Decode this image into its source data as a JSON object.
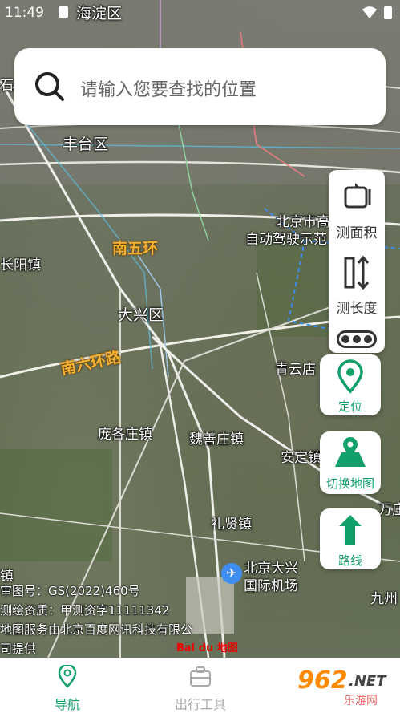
{
  "status_bar": {
    "time": "11:49",
    "district": "海淀区"
  },
  "search": {
    "placeholder": "请输入您要查找的位置"
  },
  "map_labels": {
    "fengtai": "丰台区",
    "south_5th_ring": "南五环",
    "changyang": "长阳镇",
    "daxing": "大兴区",
    "south_6th_ring": "南六环路",
    "qingyundian": "青云店",
    "panggezhuang": "庞各庄镇",
    "weishanzhuang": "魏善庄镇",
    "anding": "安定镇",
    "lixian": "礼贤镇",
    "airport_line1": "北京大兴",
    "airport_line2": "国际机场",
    "wanzhuang": "万庄",
    "jiuzhou": "九州",
    "beijing_city_line1": "北京市高",
    "beijing_city_line2": "自动驾驶示范",
    "town_left": "镇",
    "top_left": "石景"
  },
  "tools": {
    "area_label": "测面积",
    "length_label": "测长度",
    "locate_label": "定位",
    "switch_map_label": "切换地图",
    "route_label": "路线"
  },
  "copyright": {
    "line1": "审图号：GS(2022)460号",
    "line2": "测绘资质：甲测资字11111342",
    "line3": "地图服务由北京百度网讯科技有限公",
    "line4": "司提供",
    "baidu": "Bai du 地图"
  },
  "tabbar": {
    "nav_label": "导航",
    "tools_label": "出行工具",
    "active_color": "#11a06a"
  },
  "watermark": {
    "number": "962",
    "net": ".NET",
    "sub": "乐游网"
  }
}
